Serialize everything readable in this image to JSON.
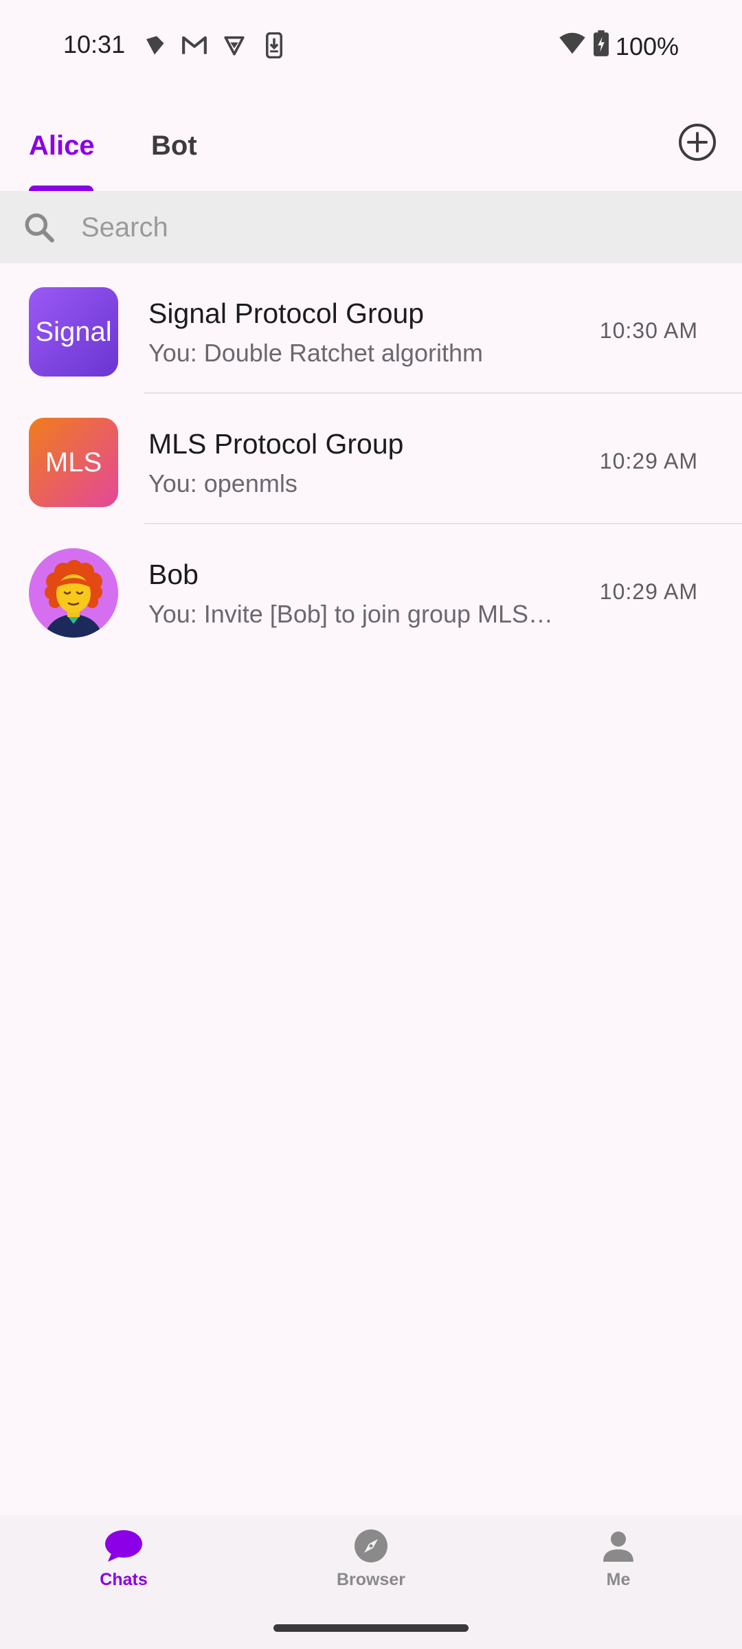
{
  "status_bar": {
    "time": "10:31",
    "battery": "100%",
    "left_icons": [
      "signal-app-icon",
      "gmail-icon",
      "vpn-icon",
      "download-phone-icon"
    ],
    "right_icons": [
      "wifi-icon",
      "battery-charging-icon"
    ]
  },
  "tabs": [
    {
      "label": "Alice",
      "active": true
    },
    {
      "label": "Bot",
      "active": false
    }
  ],
  "add_button_icon": "add-circle-icon",
  "search": {
    "placeholder": "Search",
    "value": ""
  },
  "chats": [
    {
      "avatar_text": "Signal",
      "name": "Signal Protocol Group",
      "preview": "You: Double Ratchet algorithm",
      "time": "10:30 AM"
    },
    {
      "avatar_text": "MLS",
      "name": "MLS Protocol Group",
      "preview": "You: openmls",
      "time": "10:29 AM"
    },
    {
      "avatar_text": "",
      "name": "Bob",
      "preview": "You: Invite [Bob] to join group MLS…",
      "time": "10:29 AM"
    }
  ],
  "bottom_nav": [
    {
      "label": "Chats",
      "icon": "chat-bubble-icon",
      "active": true
    },
    {
      "label": "Browser",
      "icon": "compass-icon",
      "active": false
    },
    {
      "label": "Me",
      "icon": "person-icon",
      "active": false
    }
  ],
  "colors": {
    "accent": "#8b00e6",
    "background": "#fdf6fb",
    "search_bg": "#ececec",
    "inactive": "#8a8a8a"
  }
}
